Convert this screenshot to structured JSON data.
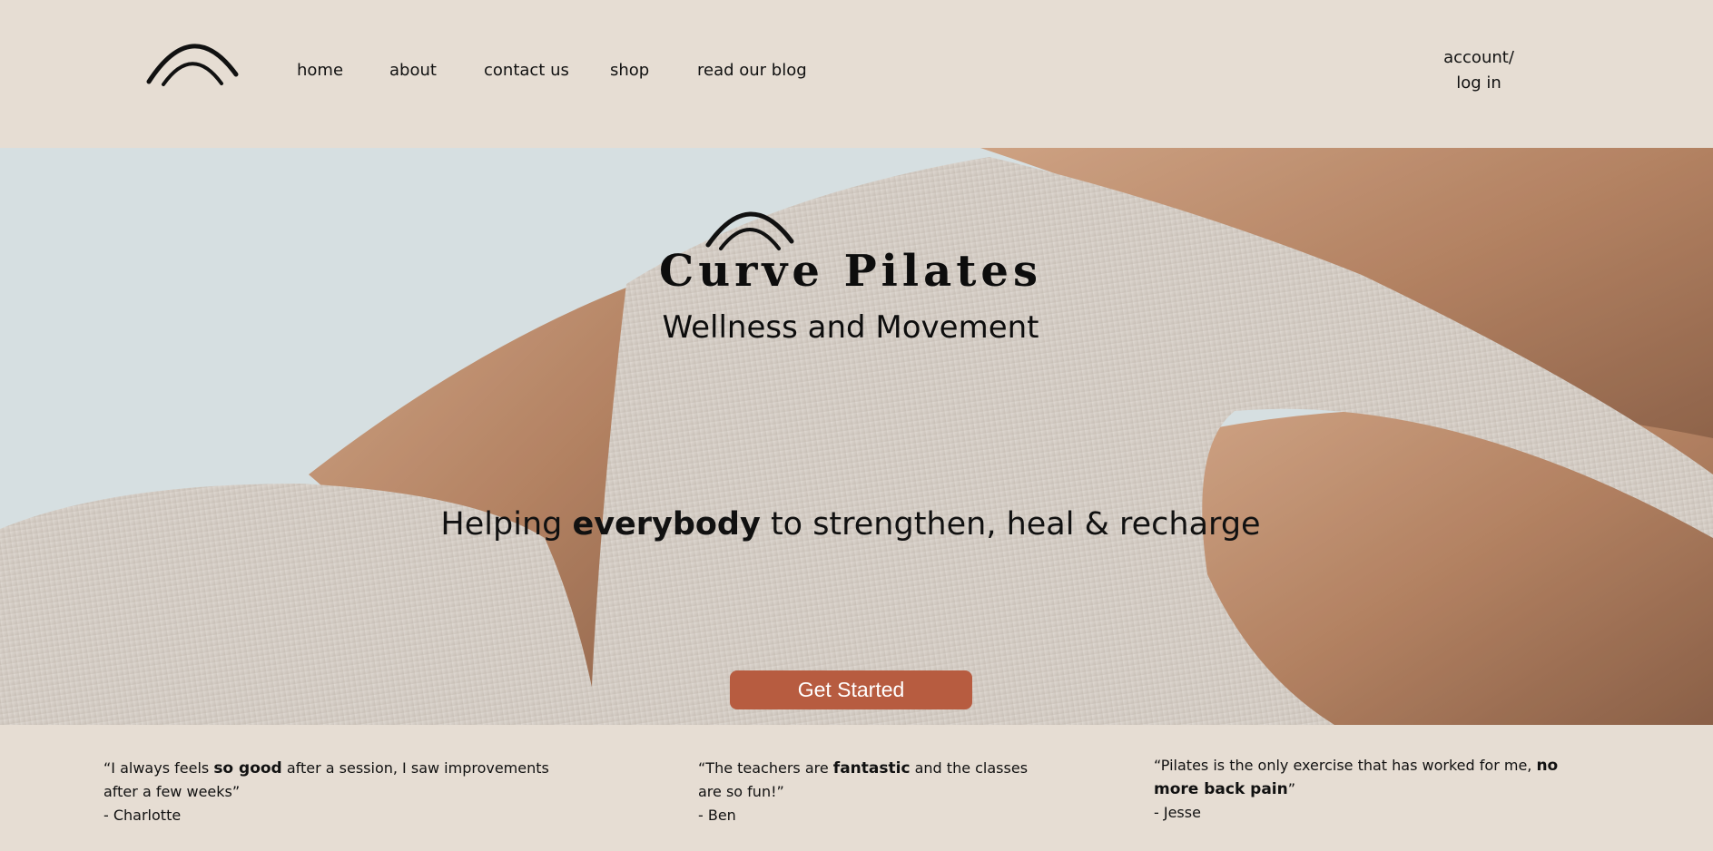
{
  "header": {
    "logo_name": "curve-arch-logo",
    "nav": [
      {
        "label": "home"
      },
      {
        "label": "about"
      },
      {
        "label": "contact us"
      },
      {
        "label": "shop"
      },
      {
        "label": "read our blog"
      }
    ],
    "account_line1": "account/",
    "account_line2": "log in"
  },
  "hero": {
    "title": "Curve Pilates",
    "subtitle": "Wellness and Movement",
    "tagline_pre": "Helping ",
    "tagline_bold": "everybody",
    "tagline_post": " to strengthen, heal & recharge",
    "cta_label": "Get Started"
  },
  "testimonials": [
    {
      "quote_pre": "“I always feels ",
      "quote_bold": "so good",
      "quote_post": " after a session, I saw improvements after a few weeks”",
      "author": "- Charlotte"
    },
    {
      "quote_pre": "“The teachers are ",
      "quote_bold": "fantastic",
      "quote_post": " and the classes are so fun!”",
      "author": "- Ben"
    },
    {
      "quote_pre": "“Pilates is the only exercise that has worked for me, ",
      "quote_bold": "no more back pain",
      "quote_post": "”",
      "author": "- Jesse"
    }
  ],
  "colors": {
    "background": "#e6ddd3",
    "cta": "#b75c40",
    "text": "#111111"
  }
}
